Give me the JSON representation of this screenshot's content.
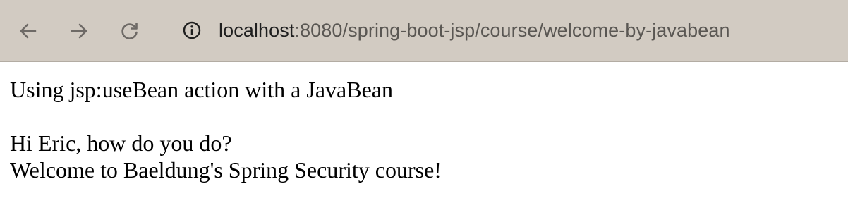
{
  "browser": {
    "nav": {
      "back_icon": "arrow-left-icon",
      "forward_icon": "arrow-right-icon",
      "reload_icon": "reload-icon"
    },
    "address_bar": {
      "info_icon": "info-circle-icon",
      "host": "localhost",
      "rest": ":8080/spring-boot-jsp/course/welcome-by-javabean"
    },
    "colors": {
      "toolbar_bg": "#d2cbc2",
      "icon_color": "#6e6a66",
      "url_host": "#1f1f1f",
      "url_rest": "#5a5753"
    }
  },
  "page": {
    "heading": "Using jsp:useBean action with a JavaBean",
    "greeting": "Hi Eric, how do you do?",
    "welcome": "Welcome to Baeldung's Spring Security course!"
  }
}
